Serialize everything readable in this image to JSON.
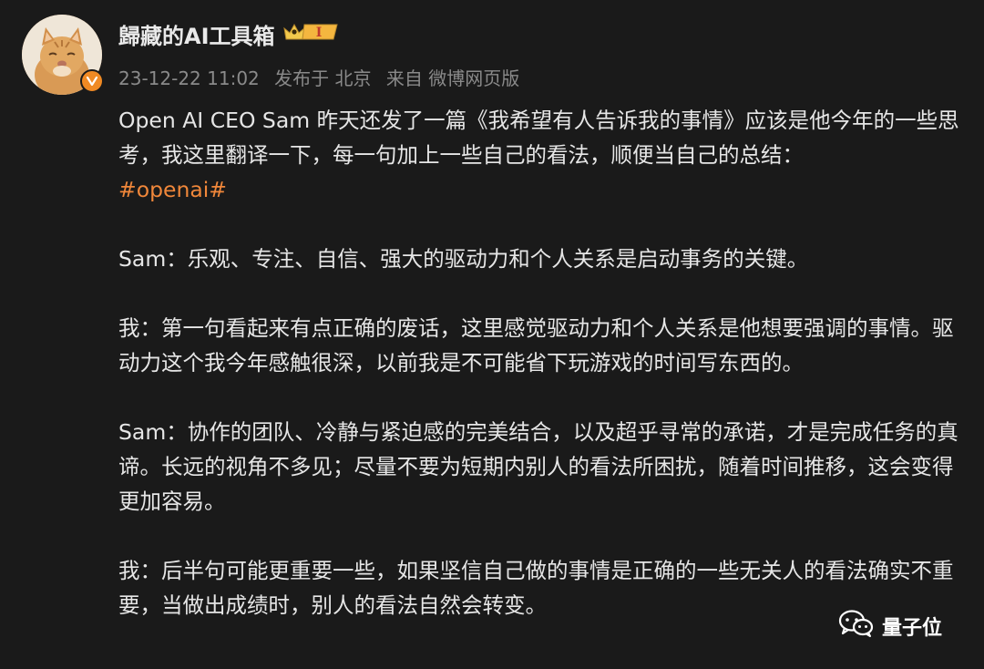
{
  "post": {
    "username": "歸藏的AI工具箱",
    "vip_level": "I",
    "timestamp": "23-12-22 11:02",
    "published_at": "发布于 北京",
    "source": "来自 微博网页版",
    "paragraph1_text": "Open AI CEO Sam 昨天还发了一篇《我希望有人告诉我的事情》应该是他今年的一些思考，我这里翻译一下，每一句加上一些自己的看法，顺便当自己的总结：",
    "hashtag": "#openai#",
    "paragraph2": "Sam：乐观、专注、自信、强大的驱动力和个人关系是启动事务的关键。",
    "paragraph3": "我：第一句看起来有点正确的废话，这里感觉驱动力和个人关系是他想要强调的事情。驱动力这个我今年感触很深，以前我是不可能省下玩游戏的时间写东西的。",
    "paragraph4": "Sam：协作的团队、冷静与紧迫感的完美结合，以及超乎寻常的承诺，才是完成任务的真谛。长远的视角不多见；尽量不要为短期内别人的看法所困扰，随着时间推移，这会变得更加容易。",
    "paragraph5": "我：后半句可能更重要一些，如果坚信自己做的事情是正确的一些无关人的看法确实不重要，当做出成绩时，别人的看法自然会转变。"
  },
  "watermark": {
    "label": "量子位",
    "icon": "wechat-icon"
  },
  "colors": {
    "background": "#1a1a1a",
    "text": "#e6e6e6",
    "meta": "#8a8a8a",
    "hashtag": "#f0873a",
    "verified_badge": "#f08a24"
  }
}
